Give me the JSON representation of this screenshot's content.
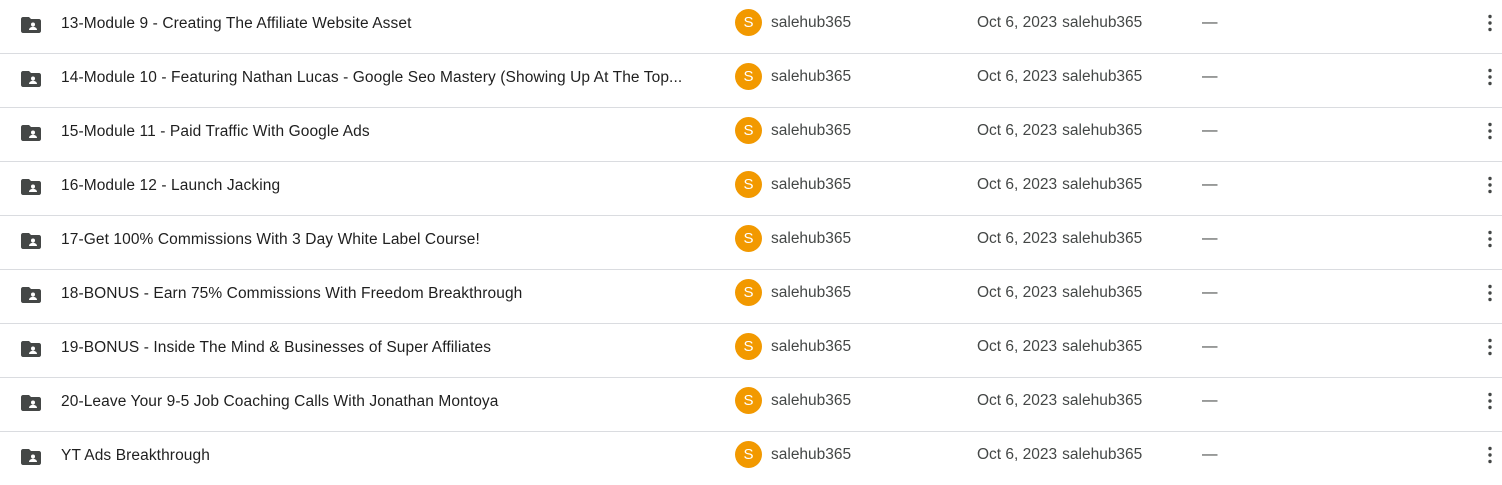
{
  "colors": {
    "avatar_bg": "#f29900",
    "folder_icon": "#444746",
    "divider": "#dadce0"
  },
  "rows": [
    {
      "icon": "shared-folder-icon",
      "name": "13-Module 9 - Creating The Affiliate Website Asset",
      "owner_initial": "S",
      "owner": "salehub365",
      "modified_date": "Oct 6, 2023",
      "modified_by": "salehub365",
      "size": "—"
    },
    {
      "icon": "shared-folder-icon",
      "name": "14-Module 10 - Featuring Nathan Lucas - Google Seo Mastery (Showing Up At The Top...",
      "owner_initial": "S",
      "owner": "salehub365",
      "modified_date": "Oct 6, 2023",
      "modified_by": "salehub365",
      "size": "—"
    },
    {
      "icon": "shared-folder-icon",
      "name": "15-Module 11 - Paid Traffic With Google Ads",
      "owner_initial": "S",
      "owner": "salehub365",
      "modified_date": "Oct 6, 2023",
      "modified_by": "salehub365",
      "size": "—"
    },
    {
      "icon": "shared-folder-icon",
      "name": "16-Module 12 - Launch Jacking",
      "owner_initial": "S",
      "owner": "salehub365",
      "modified_date": "Oct 6, 2023",
      "modified_by": "salehub365",
      "size": "—"
    },
    {
      "icon": "shared-folder-icon",
      "name": "17-Get 100% Commissions With 3 Day White Label Course!",
      "owner_initial": "S",
      "owner": "salehub365",
      "modified_date": "Oct 6, 2023",
      "modified_by": "salehub365",
      "size": "—"
    },
    {
      "icon": "shared-folder-icon",
      "name": "18-BONUS - Earn 75% Commissions With Freedom Breakthrough",
      "owner_initial": "S",
      "owner": "salehub365",
      "modified_date": "Oct 6, 2023",
      "modified_by": "salehub365",
      "size": "—"
    },
    {
      "icon": "shared-folder-icon",
      "name": "19-BONUS - Inside The Mind & Businesses of Super Affiliates",
      "owner_initial": "S",
      "owner": "salehub365",
      "modified_date": "Oct 6, 2023",
      "modified_by": "salehub365",
      "size": "—"
    },
    {
      "icon": "shared-folder-icon",
      "name": "20-Leave Your 9-5 Job Coaching Calls With Jonathan Montoya",
      "owner_initial": "S",
      "owner": "salehub365",
      "modified_date": "Oct 6, 2023",
      "modified_by": "salehub365",
      "size": "—"
    },
    {
      "icon": "shared-folder-icon",
      "name": "YT Ads Breakthrough",
      "owner_initial": "S",
      "owner": "salehub365",
      "modified_date": "Oct 6, 2023",
      "modified_by": "salehub365",
      "size": "—"
    }
  ]
}
